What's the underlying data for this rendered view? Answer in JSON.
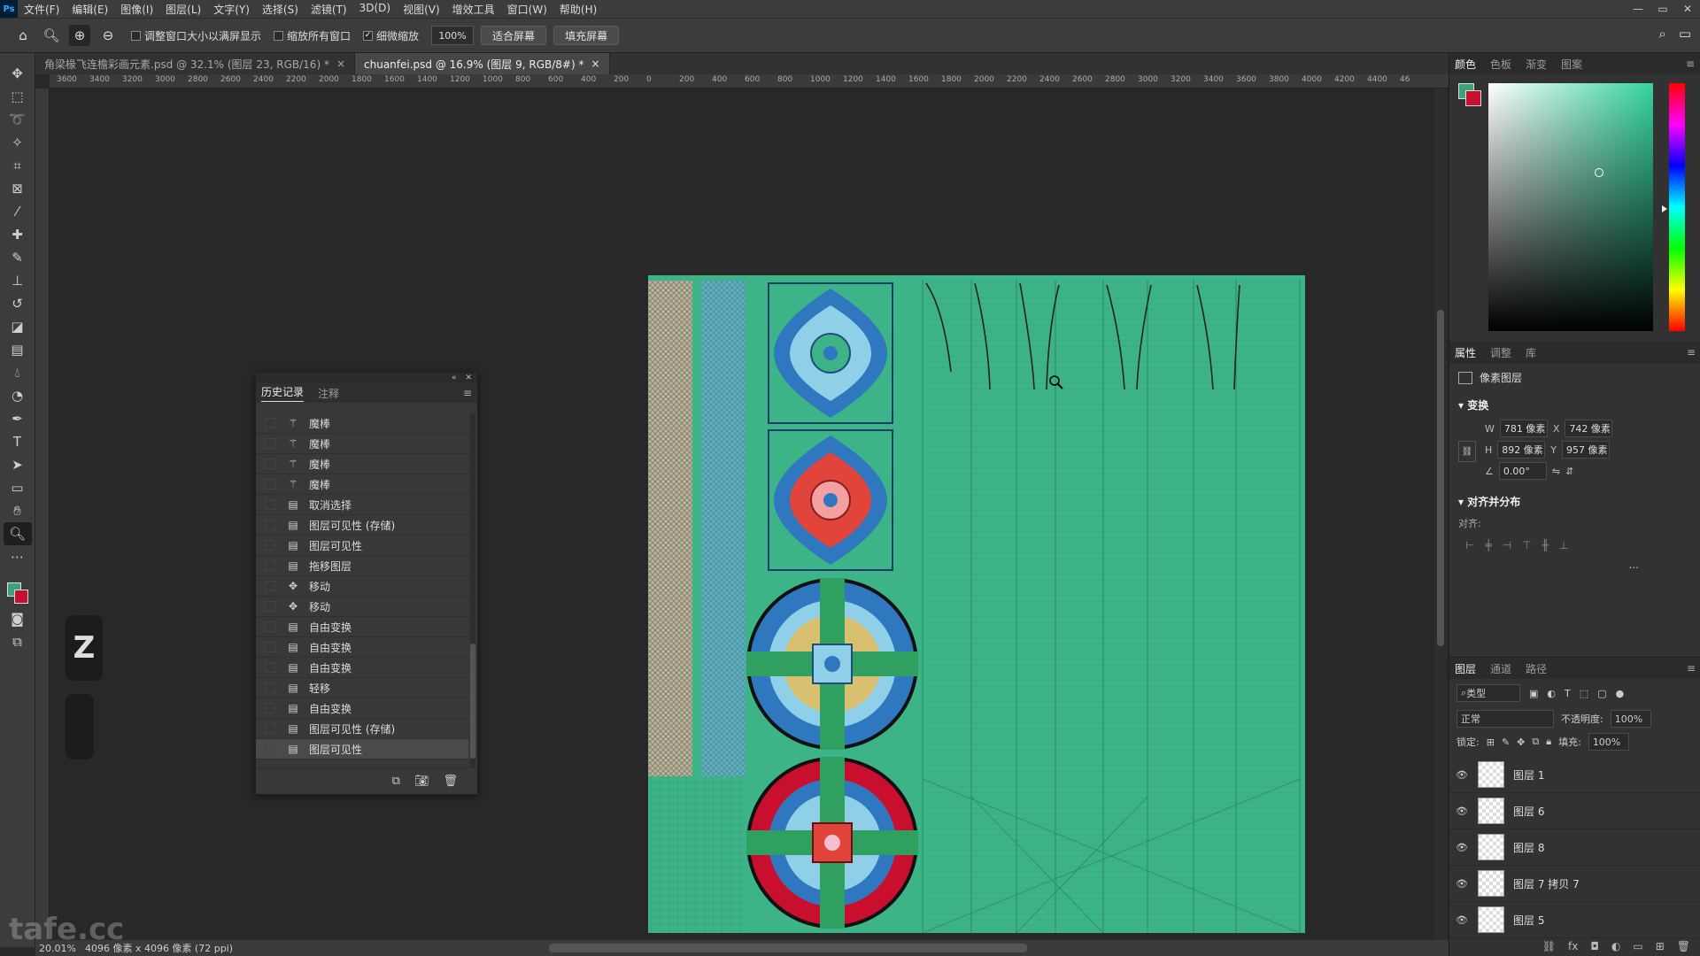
{
  "menubar": {
    "logo": "Ps",
    "items": [
      "文件(F)",
      "编辑(E)",
      "图像(I)",
      "图层(L)",
      "文字(Y)",
      "选择(S)",
      "滤镜(T)",
      "3D(D)",
      "视图(V)",
      "增效工具",
      "窗口(W)",
      "帮助(H)"
    ],
    "window_buttons": [
      "—",
      "▭",
      "✕"
    ]
  },
  "options_bar": {
    "check1_label": "调整窗口大小以满屏显示",
    "check2_label": "缩放所有窗口",
    "check3_label": "细微缩放",
    "zoom_value": "100%",
    "fit_button": "适合屏幕",
    "fill_button": "填充屏幕"
  },
  "tabs": [
    {
      "label": "角梁椽飞连檐彩画元素.psd @ 32.1% (图层 23, RGB/16) *",
      "active": false
    },
    {
      "label": "chuanfei.psd @ 16.9% (图层 9, RGB/8#) *",
      "active": true
    }
  ],
  "ruler_ticks": [
    "3600",
    "3400",
    "3200",
    "3000",
    "2800",
    "2600",
    "2400",
    "2200",
    "2000",
    "1800",
    "1600",
    "1400",
    "1200",
    "1000",
    "800",
    "600",
    "400",
    "200",
    "0",
    "200",
    "400",
    "600",
    "800",
    "1000",
    "1200",
    "1400",
    "1600",
    "1800",
    "2000",
    "2200",
    "2400",
    "2600",
    "2800",
    "3000",
    "3200",
    "3400",
    "3600",
    "3800",
    "4000",
    "4200",
    "4400",
    "46"
  ],
  "history_panel": {
    "tabs": [
      "历史记录",
      "注释"
    ],
    "items": [
      {
        "icon": "magic-wand",
        "label": "魔棒"
      },
      {
        "icon": "magic-wand",
        "label": "魔棒"
      },
      {
        "icon": "magic-wand",
        "label": "魔棒"
      },
      {
        "icon": "magic-wand",
        "label": "魔棒"
      },
      {
        "icon": "doc",
        "label": "取消选择"
      },
      {
        "icon": "doc",
        "label": "图层可见性 (存储)"
      },
      {
        "icon": "doc",
        "label": "图层可见性"
      },
      {
        "icon": "doc",
        "label": "拖移图层"
      },
      {
        "icon": "move",
        "label": "移动"
      },
      {
        "icon": "move",
        "label": "移动"
      },
      {
        "icon": "doc",
        "label": "自由变换"
      },
      {
        "icon": "doc",
        "label": "自由变换"
      },
      {
        "icon": "doc",
        "label": "自由变换"
      },
      {
        "icon": "doc",
        "label": "轻移"
      },
      {
        "icon": "doc",
        "label": "自由变换"
      },
      {
        "icon": "doc",
        "label": "图层可见性 (存储)"
      },
      {
        "icon": "doc",
        "label": "图层可见性"
      }
    ]
  },
  "keycast": {
    "key": "Z"
  },
  "watermark": "tafe.cc",
  "status": {
    "zoom": "20.01%",
    "doc_info": "4096 像素 x 4096 像素 (72 ppi)"
  },
  "right_panel": {
    "color_tabs": [
      "颜色",
      "色板",
      "渐变",
      "图案"
    ],
    "props_tabs": [
      "属性",
      "调整",
      "库"
    ],
    "pixel_layer": "像素图层",
    "transform_title": "变换",
    "w_label": "W",
    "w_value": "781 像素",
    "x_label": "X",
    "x_value": "742 像素",
    "h_label": "H",
    "h_value": "892 像素",
    "y_label": "Y",
    "y_value": "957 像素",
    "angle_value": "0.00°",
    "align_title": "对齐并分布",
    "align_label": "对齐:",
    "more": "...",
    "layers_tabs": [
      "图层",
      "通道",
      "路径"
    ],
    "filter_kind": "类型",
    "blend_mode": "正常",
    "opacity_label": "不透明度:",
    "opacity_value": "100%",
    "lock_label": "锁定:",
    "fill_label": "填充:",
    "fill_value": "100%",
    "layers": [
      "图层 1",
      "图层 6",
      "图层 8",
      "图层 7 拷贝 7",
      "图层 5"
    ]
  },
  "colors": {
    "foreground": "#3aa37c",
    "background": "#c8102e",
    "canvas_green": "#3db488"
  }
}
